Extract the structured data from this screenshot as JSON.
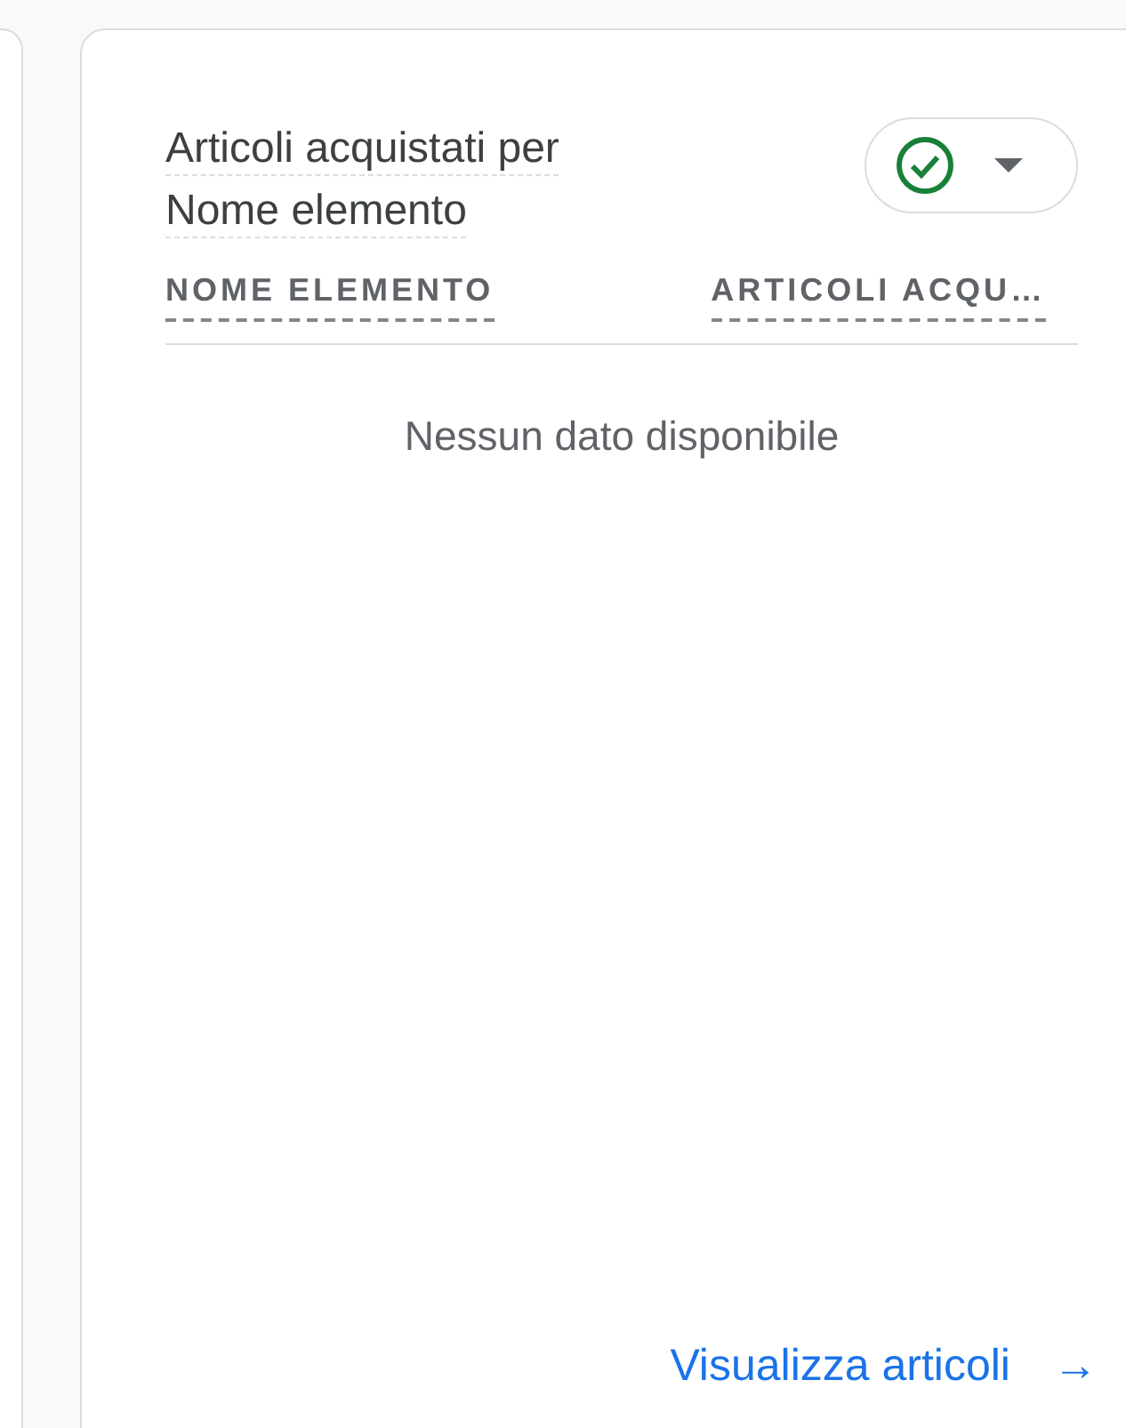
{
  "card": {
    "title_lines": [
      "Articoli acquistati per",
      "Nome elemento"
    ],
    "table": {
      "columns": [
        "NOME ELEMENTO",
        "ARTICOLI ACQU…"
      ],
      "empty_message": "Nessun dato disponibile"
    },
    "footer_link": {
      "label": "Visualizza articoli",
      "arrow": "→"
    }
  }
}
